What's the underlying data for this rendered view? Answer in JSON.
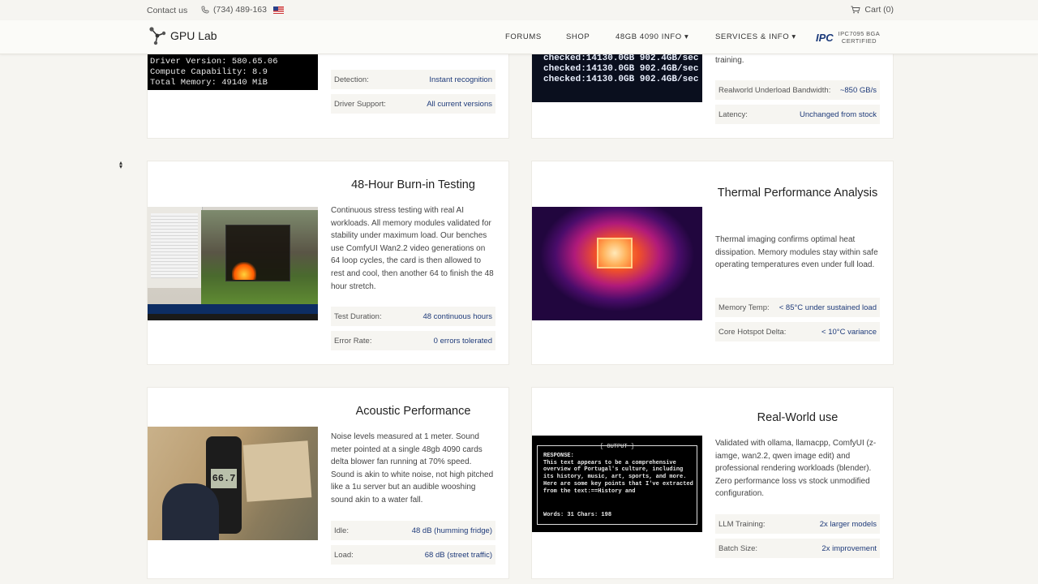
{
  "topbar": {
    "contact": "Contact us",
    "phone": "(734) 489-163",
    "cart": "Cart (0)"
  },
  "nav": {
    "brand": "GPU Lab",
    "links": [
      "FORUMS",
      "SHOP",
      "48GB 4090 INFO ▾",
      "SERVICES & INFO ▾"
    ],
    "ipc_logo": "IPC",
    "ipc_line1": "IPC7095 BGA",
    "ipc_line2": "CERTIFIED"
  },
  "cards": {
    "driver": {
      "terminal": [
        "Driver Version: 580.65.06",
        "Compute Capability: 8.9",
        "Total Memory: 49140 MiB"
      ],
      "rows": [
        {
          "k": "Detection:",
          "v": "Instant recognition"
        },
        {
          "k": "Driver Support:",
          "v": "All current versions"
        }
      ]
    },
    "bandwidth": {
      "terminal": [
        "checked:14130.0GB 902.4GB/sec",
        "checked:14130.0GB 902.4GB/sec",
        "checked:14130.0GB 902.4GB/sec"
      ],
      "desc_tail": "training.",
      "rows": [
        {
          "k": "Realworld Underload Bandwidth:",
          "v": "~850 GB/s"
        },
        {
          "k": "Latency:",
          "v": "Unchanged from stock"
        }
      ]
    },
    "burnin": {
      "title": "48-Hour Burn-in Testing",
      "desc": "Continuous stress testing with real AI workloads. All memory modules validated for stability under maximum load. Our benches use ComfyUI Wan2.2 video generations on 64 loop cycles, the card is then allowed to rest and cool, then another 64 to finish the 48 hour stretch.",
      "rows": [
        {
          "k": "Test Duration:",
          "v": "48 continuous hours"
        },
        {
          "k": "Error Rate:",
          "v": "0 errors tolerated"
        }
      ]
    },
    "thermal": {
      "title": "Thermal Performance Analysis",
      "desc": "Thermal imaging confirms optimal heat dissipation. Memory modules stay within safe operating temperatures even under full load.",
      "rows": [
        {
          "k": "Memory Temp:",
          "v": "< 85°C under sustained load"
        },
        {
          "k": "Core Hotspot Delta:",
          "v": "< 10°C variance"
        }
      ]
    },
    "acoustic": {
      "title": "Acoustic Performance",
      "desc": "Noise levels measured at 1 meter. Sound meter pointed at a single 48gb 4090 cards delta blower fan running at 70% speed. Sound is akin to white noise, not high pitched like a 1u server but an audible wooshing sound akin to a water fall.",
      "meter_reading": "66.7",
      "rows": [
        {
          "k": "Idle:",
          "v": "48 dB (humming fridge)"
        },
        {
          "k": "Load:",
          "v": "68 dB (street traffic)"
        }
      ]
    },
    "realworld": {
      "title": "Real-World use",
      "desc": "Validated with ollama, llamacpp, ComfyUI (z-iamge, wan2.2, qwen image edit) and professional rendering workloads (blender). Zero performance loss vs stock unmodified configuration.",
      "terminal_header": "[ OUTPUT ]",
      "terminal": [
        "RESPONSE:",
        "This text appears to be a comprehensive",
        "overview of Portugal's culture, including",
        "its history, music, art, sports, and more.",
        "Here are some key points that I've extracted",
        "from the text:==History and"
      ],
      "terminal_footer": "Words: 31  Chars: 198",
      "rows": [
        {
          "k": "LLM Training:",
          "v": "2x larger models"
        },
        {
          "k": "Batch Size:",
          "v": "2x improvement"
        }
      ]
    }
  }
}
